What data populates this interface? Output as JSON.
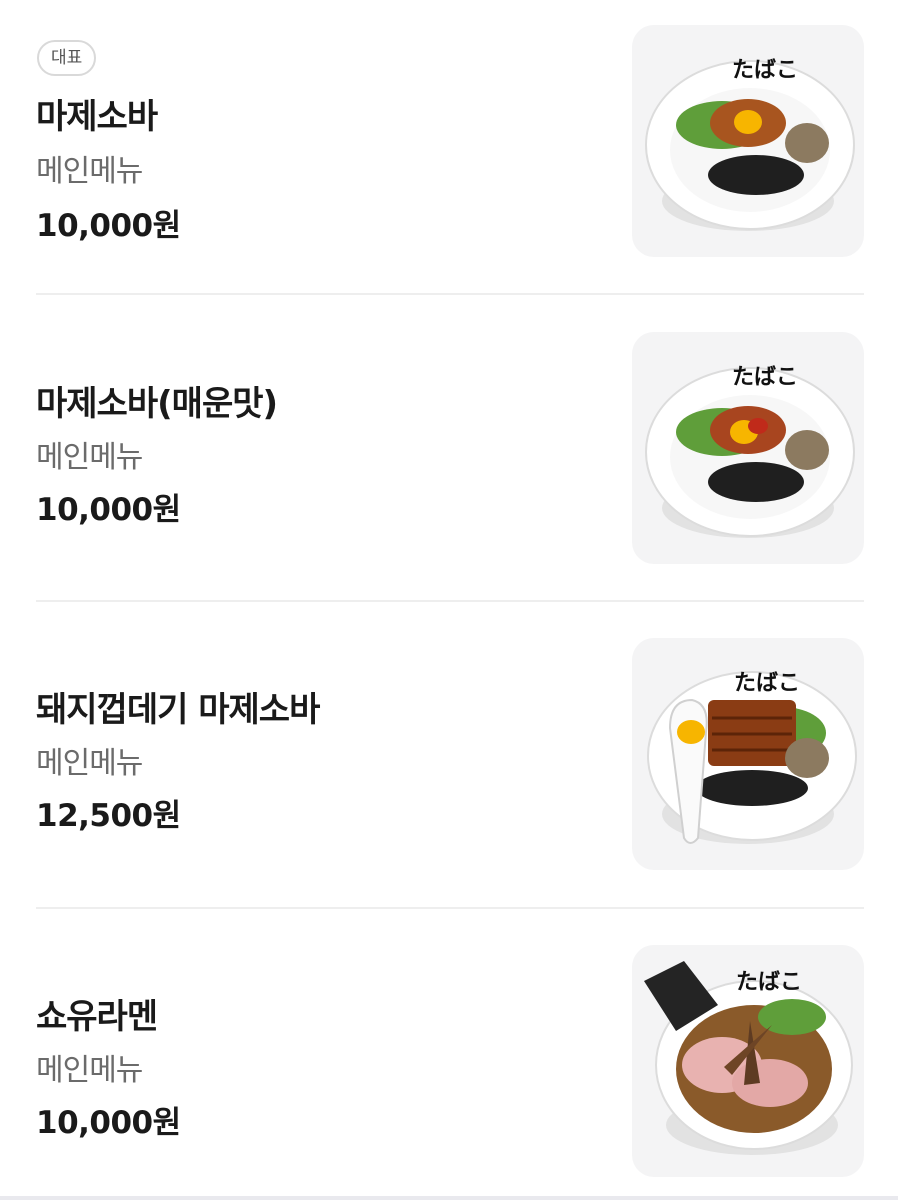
{
  "menu": {
    "items": [
      {
        "badge": "대표",
        "name": "마제소바",
        "category": "메인메뉴",
        "price": "10,000원",
        "image_icon": "mazesoba-bowl-icon"
      },
      {
        "name": "마제소바(매운맛)",
        "category": "메인메뉴",
        "price": "10,000원",
        "image_icon": "spicy-mazesoba-bowl-icon"
      },
      {
        "name": "돼지껍데기 마제소바",
        "category": "메인메뉴",
        "price": "12,500원",
        "image_icon": "pork-skin-mazesoba-bowl-icon"
      },
      {
        "name": "쇼유라멘",
        "category": "메인메뉴",
        "price": "10,000원",
        "image_icon": "shoyu-ramen-bowl-icon"
      }
    ]
  },
  "colors": {
    "text_primary": "#1a1a1a",
    "text_secondary": "#6b6b6b",
    "divider": "#eeeeee",
    "thumb_bg": "#f4f4f5"
  }
}
